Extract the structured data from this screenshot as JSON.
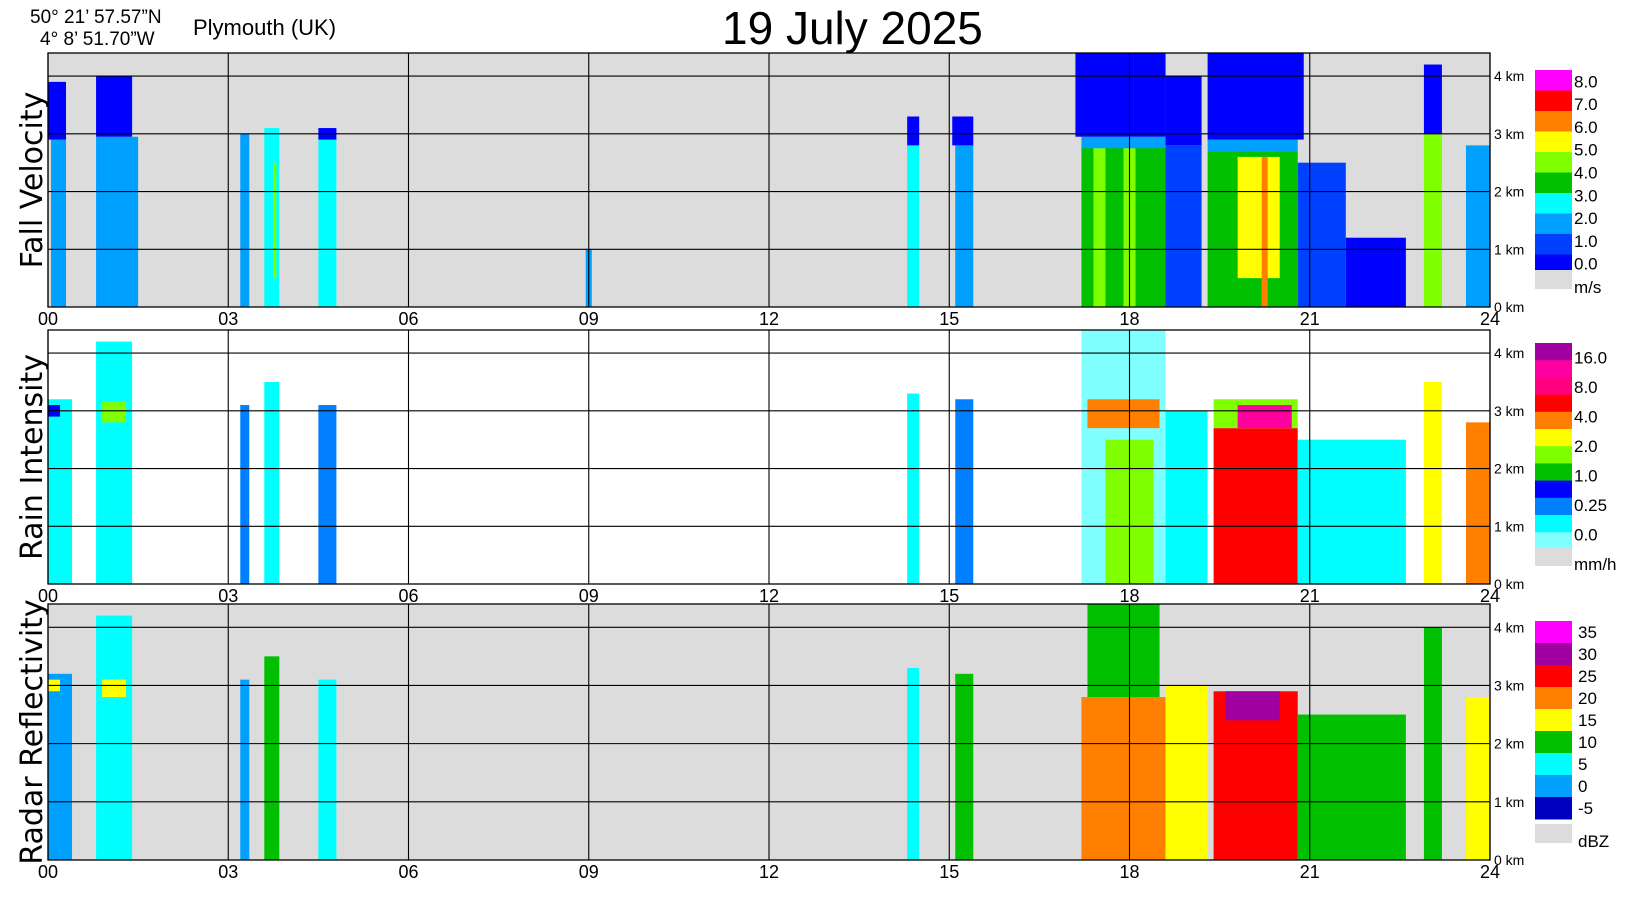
{
  "header": {
    "lat": "50° 21’ 57.57”N",
    "lon": "4°  8’ 51.70”W",
    "place": "Plymouth (UK)",
    "date": "19 July  2025"
  },
  "colors": {
    "no_data_gray": "#dcdcdc",
    "grid": "#000000"
  },
  "chart_data": [
    {
      "type": "heatmap",
      "ylabel": "Fall Velocity",
      "unit": "m/s",
      "background": "#dcdcdc",
      "x_ticks": [
        "00",
        "03",
        "06",
        "09",
        "12",
        "15",
        "18",
        "21",
        "24"
      ],
      "xlim": [
        0,
        24
      ],
      "y_ticks": [
        "0 km",
        "1 km",
        "2 km",
        "3 km",
        "4 km"
      ],
      "ylim_km": [
        0,
        4.4
      ],
      "colorbar": {
        "labels": [
          "8.0",
          "7.0",
          "6.0",
          "5.0",
          "4.0",
          "3.0",
          "2.0",
          "1.0",
          "0.0"
        ],
        "colors": [
          "#ff00ff",
          "#ff0000",
          "#ff8000",
          "#ffff00",
          "#80ff00",
          "#00c000",
          "#00ffff",
          "#00a0ff",
          "#0040ff",
          "#0000ff"
        ],
        "nodata_label": "m/s"
      },
      "cells": [
        {
          "t0": 0.05,
          "t1": 0.3,
          "h0": 0,
          "h1": 2.9,
          "c": 2
        },
        {
          "t0": 0,
          "t1": 0.3,
          "h0": 2.9,
          "h1": 3.9,
          "c": 0
        },
        {
          "t0": 0.8,
          "t1": 1.5,
          "h0": 0,
          "h1": 2.95,
          "c": 2
        },
        {
          "t0": 0.8,
          "t1": 1.4,
          "h0": 2.95,
          "h1": 4.0,
          "c": 0
        },
        {
          "t0": 3.2,
          "t1": 3.35,
          "h0": 0,
          "h1": 3.0,
          "c": 2
        },
        {
          "t0": 3.6,
          "t1": 3.85,
          "h0": 0,
          "h1": 3.1,
          "c": 3
        },
        {
          "t0": 3.75,
          "t1": 3.8,
          "h0": 0.5,
          "h1": 2.5,
          "c": 5
        },
        {
          "t0": 4.5,
          "t1": 4.8,
          "h0": 0,
          "h1": 2.9,
          "c": 3
        },
        {
          "t0": 4.5,
          "t1": 4.8,
          "h0": 2.9,
          "h1": 3.1,
          "c": 0
        },
        {
          "t0": 8.95,
          "t1": 9.05,
          "h0": 0,
          "h1": 1.0,
          "c": 2
        },
        {
          "t0": 14.3,
          "t1": 14.5,
          "h0": 0,
          "h1": 2.8,
          "c": 3
        },
        {
          "t0": 14.3,
          "t1": 14.5,
          "h0": 2.8,
          "h1": 3.3,
          "c": 0
        },
        {
          "t0": 15.1,
          "t1": 15.4,
          "h0": 0,
          "h1": 2.8,
          "c": 2
        },
        {
          "t0": 15.05,
          "t1": 15.4,
          "h0": 2.8,
          "h1": 3.3,
          "c": 0
        },
        {
          "t0": 17.2,
          "t1": 18.6,
          "h0": 0,
          "h1": 2.8,
          "c": 4
        },
        {
          "t0": 17.4,
          "t1": 17.6,
          "h0": 0,
          "h1": 2.8,
          "c": 5
        },
        {
          "t0": 17.9,
          "t1": 18.1,
          "h0": 0,
          "h1": 2.8,
          "c": 5
        },
        {
          "t0": 17.2,
          "t1": 18.6,
          "h0": 2.75,
          "h1": 2.95,
          "c": 2
        },
        {
          "t0": 17.1,
          "t1": 18.6,
          "h0": 2.95,
          "h1": 4.4,
          "c": 0
        },
        {
          "t0": 18.6,
          "t1": 19.2,
          "h0": 0,
          "h1": 2.8,
          "c": 1
        },
        {
          "t0": 18.6,
          "t1": 19.2,
          "h0": 2.8,
          "h1": 4.0,
          "c": 0
        },
        {
          "t0": 19.3,
          "t1": 20.8,
          "h0": 0,
          "h1": 2.7,
          "c": 4
        },
        {
          "t0": 19.8,
          "t1": 20.5,
          "h0": 0.5,
          "h1": 2.6,
          "c": 6
        },
        {
          "t0": 20.2,
          "t1": 20.3,
          "h0": 0,
          "h1": 2.6,
          "c": 7
        },
        {
          "t0": 19.3,
          "t1": 20.8,
          "h0": 2.7,
          "h1": 2.9,
          "c": 2
        },
        {
          "t0": 19.3,
          "t1": 20.9,
          "h0": 2.9,
          "h1": 4.4,
          "c": 0
        },
        {
          "t0": 20.8,
          "t1": 21.6,
          "h0": 0,
          "h1": 2.5,
          "c": 1
        },
        {
          "t0": 21.6,
          "t1": 22.6,
          "h0": 0,
          "h1": 1.2,
          "c": 0
        },
        {
          "t0": 22.9,
          "t1": 23.2,
          "h0": 0,
          "h1": 3.0,
          "c": 5
        },
        {
          "t0": 22.9,
          "t1": 23.2,
          "h0": 3.0,
          "h1": 4.2,
          "c": 0
        },
        {
          "t0": 23.6,
          "t1": 24,
          "h0": 0,
          "h1": 2.8,
          "c": 2
        }
      ]
    },
    {
      "type": "heatmap",
      "ylabel": "Rain Intensity",
      "unit": "mm/h",
      "background": "#ffffff",
      "x_ticks": [
        "00",
        "03",
        "06",
        "09",
        "12",
        "15",
        "18",
        "21",
        "24"
      ],
      "xlim": [
        0,
        24
      ],
      "y_ticks": [
        "0 km",
        "1 km",
        "2 km",
        "3 km",
        "4 km"
      ],
      "ylim_km": [
        0,
        4.4
      ],
      "colorbar": {
        "labels": [
          "16.0",
          "8.0",
          "4.0",
          "2.0",
          "1.0",
          "0.25",
          "0.0"
        ],
        "colors": [
          "#a000a0",
          "#ff00a0",
          "#ff0080",
          "#ff0000",
          "#ff8000",
          "#ffff00",
          "#80ff00",
          "#00c000",
          "#0000ff",
          "#0080ff",
          "#00ffff",
          "#80ffff"
        ],
        "nodata_label": "mm/h"
      },
      "cells": [
        {
          "t0": 0,
          "t1": 0.4,
          "h0": 0,
          "h1": 3.2,
          "c": 1
        },
        {
          "t0": 0,
          "t1": 0.2,
          "h0": 2.9,
          "h1": 3.1,
          "c": 3
        },
        {
          "t0": 0.8,
          "t1": 1.4,
          "h0": 0,
          "h1": 4.2,
          "c": 1
        },
        {
          "t0": 0.9,
          "t1": 1.3,
          "h0": 2.8,
          "h1": 3.15,
          "c": 5
        },
        {
          "t0": 3.2,
          "t1": 3.35,
          "h0": 0,
          "h1": 3.1,
          "c": 2
        },
        {
          "t0": 3.6,
          "t1": 3.85,
          "h0": 0,
          "h1": 3.5,
          "c": 1
        },
        {
          "t0": 4.5,
          "t1": 4.8,
          "h0": 0,
          "h1": 3.1,
          "c": 2
        },
        {
          "t0": 14.3,
          "t1": 14.5,
          "h0": 0,
          "h1": 3.3,
          "c": 1
        },
        {
          "t0": 15.1,
          "t1": 15.4,
          "h0": 0,
          "h1": 3.2,
          "c": 2
        },
        {
          "t0": 17.2,
          "t1": 18.6,
          "h0": 0,
          "h1": 4.4,
          "c": 0
        },
        {
          "t0": 17.6,
          "t1": 18.4,
          "h0": 0,
          "h1": 2.5,
          "c": 5
        },
        {
          "t0": 17.3,
          "t1": 18.5,
          "h0": 2.7,
          "h1": 3.2,
          "c": 7
        },
        {
          "t0": 18.6,
          "t1": 19.3,
          "h0": 0,
          "h1": 3.0,
          "c": 1
        },
        {
          "t0": 19.4,
          "t1": 20.8,
          "h0": 0,
          "h1": 2.7,
          "c": 8
        },
        {
          "t0": 19.4,
          "t1": 20.8,
          "h0": 2.7,
          "h1": 3.2,
          "c": 5
        },
        {
          "t0": 19.8,
          "t1": 20.7,
          "h0": 2.7,
          "h1": 3.1,
          "c": 10
        },
        {
          "t0": 20.8,
          "t1": 22.6,
          "h0": 0,
          "h1": 2.5,
          "c": 1
        },
        {
          "t0": 22.9,
          "t1": 23.2,
          "h0": 0,
          "h1": 3.5,
          "c": 6
        },
        {
          "t0": 23.6,
          "t1": 24,
          "h0": 0,
          "h1": 2.8,
          "c": 7
        }
      ]
    },
    {
      "type": "heatmap",
      "ylabel": "Radar Reflectivity",
      "unit": "dBZ",
      "background": "#dcdcdc",
      "x_ticks": [
        "00",
        "03",
        "06",
        "09",
        "12",
        "15",
        "18",
        "21",
        "24"
      ],
      "xlim": [
        0,
        24
      ],
      "y_ticks": [
        "0 km",
        "1 km",
        "2 km",
        "3 km",
        "4 km"
      ],
      "ylim_km": [
        0,
        4.4
      ],
      "colorbar": {
        "labels": [
          "35",
          "30",
          "25",
          "20",
          "15",
          "10",
          "5",
          "0",
          "-5"
        ],
        "colors": [
          "#ff00ff",
          "#a000a0",
          "#ff0000",
          "#ff8000",
          "#ffff00",
          "#00c000",
          "#00ffff",
          "#00a0ff",
          "#0000c0"
        ],
        "nodata_label": "dBZ"
      },
      "cells": [
        {
          "t0": 0,
          "t1": 0.4,
          "h0": 0,
          "h1": 3.2,
          "c": 1
        },
        {
          "t0": 0,
          "t1": 0.2,
          "h0": 2.9,
          "h1": 3.1,
          "c": 4
        },
        {
          "t0": 0.8,
          "t1": 1.4,
          "h0": 0,
          "h1": 4.2,
          "c": 2
        },
        {
          "t0": 0.9,
          "t1": 1.3,
          "h0": 2.8,
          "h1": 3.1,
          "c": 4
        },
        {
          "t0": 3.2,
          "t1": 3.35,
          "h0": 0,
          "h1": 3.1,
          "c": 1
        },
        {
          "t0": 3.6,
          "t1": 3.85,
          "h0": 0,
          "h1": 3.5,
          "c": 3
        },
        {
          "t0": 4.5,
          "t1": 4.8,
          "h0": 0,
          "h1": 3.1,
          "c": 2
        },
        {
          "t0": 14.3,
          "t1": 14.5,
          "h0": 0,
          "h1": 3.3,
          "c": 2
        },
        {
          "t0": 15.1,
          "t1": 15.4,
          "h0": 0,
          "h1": 3.2,
          "c": 3
        },
        {
          "t0": 17.2,
          "t1": 18.6,
          "h0": 0,
          "h1": 2.8,
          "c": 5
        },
        {
          "t0": 17.3,
          "t1": 18.5,
          "h0": 2.8,
          "h1": 4.4,
          "c": 3
        },
        {
          "t0": 18.6,
          "t1": 19.3,
          "h0": 0,
          "h1": 3.0,
          "c": 4
        },
        {
          "t0": 19.4,
          "t1": 20.8,
          "h0": 0,
          "h1": 2.9,
          "c": 6
        },
        {
          "t0": 19.6,
          "t1": 20.5,
          "h0": 2.4,
          "h1": 2.9,
          "c": 7
        },
        {
          "t0": 20.8,
          "t1": 22.6,
          "h0": 0,
          "h1": 2.5,
          "c": 3
        },
        {
          "t0": 22.9,
          "t1": 23.2,
          "h0": 0,
          "h1": 4.0,
          "c": 3
        },
        {
          "t0": 23.6,
          "t1": 24,
          "h0": 0,
          "h1": 2.8,
          "c": 4
        }
      ]
    }
  ]
}
